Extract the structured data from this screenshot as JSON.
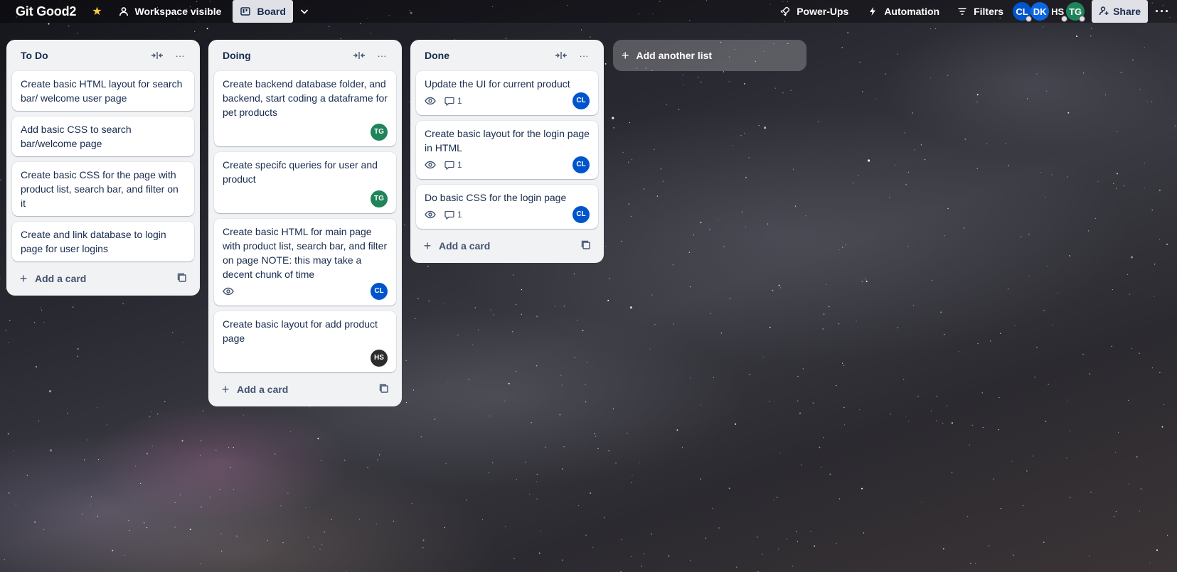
{
  "topbar": {
    "board_name": "Git Good2",
    "visibility_label": "Workspace visible",
    "view_label": "Board",
    "powerups_label": "Power-Ups",
    "automation_label": "Automation",
    "filters_label": "Filters",
    "share_label": "Share",
    "members": [
      {
        "initials": "CL",
        "color": "#0055cc"
      },
      {
        "initials": "DK",
        "color": "#0c66e4"
      },
      {
        "initials": "HS",
        "color": "#3b3b3b"
      },
      {
        "initials": "TG",
        "color": "#1f845a"
      }
    ]
  },
  "lists": [
    {
      "title": "To Do",
      "cards": [
        {
          "title": "Create basic HTML layout for search bar/ welcome user page"
        },
        {
          "title": "Add basic CSS to search bar/welcome page"
        },
        {
          "title": "Create basic CSS for the page with product list, search bar, and filter on it"
        },
        {
          "title": "Create and link database to login page for user logins"
        }
      ],
      "add_card_label": "Add a card"
    },
    {
      "title": "Doing",
      "cards": [
        {
          "title": "Create backend database folder, and backend, start coding a dataframe for pet products",
          "member": "TG"
        },
        {
          "title": "Create specifc queries for user and product",
          "member": "TG"
        },
        {
          "title": "Create basic HTML for main page with product list, search bar, and filter on page NOTE: this may take a decent chunk of time",
          "member": "CL",
          "watch": true
        },
        {
          "title": "Create basic layout for add product page",
          "member": "HS"
        }
      ],
      "add_card_label": "Add a card"
    },
    {
      "title": "Done",
      "cards": [
        {
          "title": "Update the UI for current product",
          "member": "CL",
          "watch": true,
          "comments": "1"
        },
        {
          "title": "Create basic layout for the login page in HTML",
          "member": "CL",
          "watch": true,
          "comments": "1"
        },
        {
          "title": "Do basic CSS for the login page",
          "member": "CL",
          "watch": true,
          "comments": "1"
        }
      ],
      "add_card_label": "Add a card"
    }
  ],
  "add_list_label": "Add another list",
  "colors": {
    "CL": "#0055cc",
    "TG": "#1f845a",
    "HS": "#2c2c2c"
  }
}
